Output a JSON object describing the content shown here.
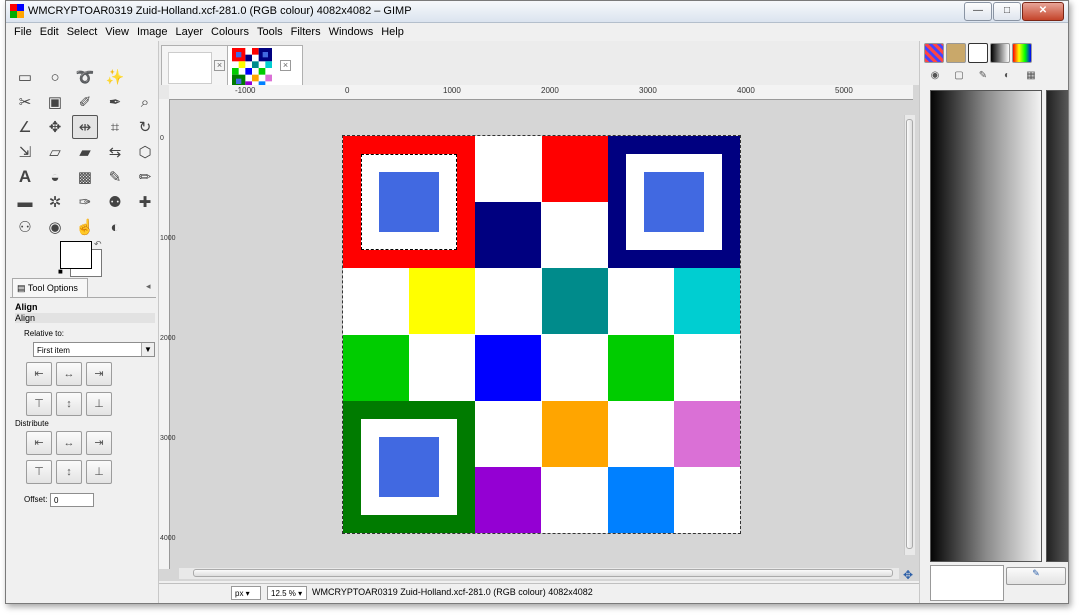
{
  "window": {
    "title": "WMCRYPTOAR0319 Zuid-Holland.xcf-281.0 (RGB colour) 4082x4082 – GIMP",
    "controls": {
      "minimize": "—",
      "maximize": "□",
      "close": "✕"
    }
  },
  "menu": [
    "File",
    "Edit",
    "Select",
    "View",
    "Image",
    "Layer",
    "Colours",
    "Tools",
    "Filters",
    "Windows",
    "Help"
  ],
  "toolbox": {
    "tools": [
      "rect-select-icon",
      "ellipse-select-icon",
      "lasso-icon",
      "fuzzy-select-icon",
      "blank",
      "scissors-icon",
      "by-color-select-icon",
      "paths-icon",
      "color-picker-icon",
      "zoom-icon",
      "measure-icon",
      "move-icon",
      "align-icon",
      "crop-icon",
      "rotate-icon",
      "scale-icon",
      "shear-icon",
      "perspective-icon",
      "flip-icon",
      "cage-icon",
      "text-icon",
      "bucket-fill-icon",
      "blend-icon",
      "pencil-icon",
      "paintbrush-icon",
      "eraser-icon",
      "airbrush-icon",
      "ink-icon",
      "clone-icon",
      "heal-icon",
      "perspective-clone-icon",
      "blur-icon",
      "smudge-icon",
      "dodge-burn-icon",
      "blank"
    ],
    "active_tool": 12
  },
  "tool_options": {
    "tab_label": "Tool Options",
    "heading": "Align",
    "subheading": "Align",
    "relative_label": "Relative to:",
    "relative_value": "First item",
    "distribute_label": "Distribute",
    "offset_label": "Offset:",
    "offset_value": "0"
  },
  "ruler": {
    "h_labels": [
      "-1000",
      "0",
      "1000",
      "2000",
      "3000",
      "4000",
      "5000"
    ],
    "v_labels": [
      "0",
      "1000",
      "2000",
      "3000",
      "4000"
    ]
  },
  "statusbar": {
    "unit": "px",
    "zoom": "12.5 %",
    "message": "WMCRYPTOAR0319 Zuid-Holland.xcf-281.0 (RGB colour) 4082x4082"
  },
  "colors": {
    "red": "#ff0000",
    "navy": "#000080",
    "yellow": "#ffff00",
    "teal": "#008b8b",
    "cyan": "#00ced1",
    "green": "#00cc00",
    "blue": "#0000ff",
    "darkgreen": "#007b00",
    "orange": "#ffa500",
    "orchid": "#da70d6",
    "purple": "#9400d3",
    "azure": "#0080ff",
    "royal": "#4169e1",
    "white": "#ffffff"
  }
}
